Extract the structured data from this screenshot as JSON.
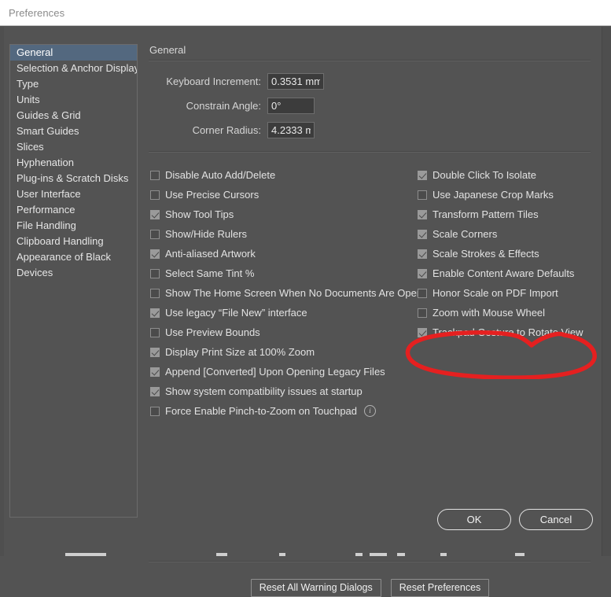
{
  "window": {
    "title": "Preferences"
  },
  "sidebar": {
    "items": [
      {
        "label": "General",
        "selected": true
      },
      {
        "label": "Selection & Anchor Display",
        "selected": false
      },
      {
        "label": "Type",
        "selected": false
      },
      {
        "label": "Units",
        "selected": false
      },
      {
        "label": "Guides & Grid",
        "selected": false
      },
      {
        "label": "Smart Guides",
        "selected": false
      },
      {
        "label": "Slices",
        "selected": false
      },
      {
        "label": "Hyphenation",
        "selected": false
      },
      {
        "label": "Plug-ins & Scratch Disks",
        "selected": false
      },
      {
        "label": "User Interface",
        "selected": false
      },
      {
        "label": "Performance",
        "selected": false
      },
      {
        "label": "File Handling",
        "selected": false
      },
      {
        "label": "Clipboard Handling",
        "selected": false
      },
      {
        "label": "Appearance of Black",
        "selected": false
      },
      {
        "label": "Devices",
        "selected": false
      }
    ]
  },
  "pane": {
    "title": "General",
    "fields": [
      {
        "label": "Keyboard Increment:",
        "value": "0.3531 mm",
        "name": "keyboard-increment"
      },
      {
        "label": "Constrain Angle:",
        "value": "0°",
        "name": "constrain-angle"
      },
      {
        "label": "Corner Radius:",
        "value": "4.2333 m",
        "name": "corner-radius"
      }
    ],
    "checkboxes_left": [
      {
        "label": "Disable Auto Add/Delete",
        "checked": false
      },
      {
        "label": "Use Precise Cursors",
        "checked": false
      },
      {
        "label": "Show Tool Tips",
        "checked": true
      },
      {
        "label": "Show/Hide Rulers",
        "checked": false
      },
      {
        "label": "Anti-aliased Artwork",
        "checked": true
      },
      {
        "label": "Select Same Tint %",
        "checked": false
      },
      {
        "label": "Show The Home Screen When No Documents Are Open",
        "checked": false
      },
      {
        "label": "Use legacy “File New” interface",
        "checked": true
      },
      {
        "label": "Use Preview Bounds",
        "checked": false
      },
      {
        "label": "Display Print Size at 100% Zoom",
        "checked": true
      },
      {
        "label": "Append [Converted] Upon Opening Legacy Files",
        "checked": true
      },
      {
        "label": "Show system compatibility issues at startup",
        "checked": true
      },
      {
        "label": "Force Enable Pinch-to-Zoom on Touchpad",
        "checked": false,
        "info": true
      }
    ],
    "checkboxes_right": [
      {
        "label": "Double Click To Isolate",
        "checked": true
      },
      {
        "label": "Use Japanese Crop Marks",
        "checked": false
      },
      {
        "label": "Transform Pattern Tiles",
        "checked": true
      },
      {
        "label": "Scale Corners",
        "checked": true
      },
      {
        "label": "Scale Strokes & Effects",
        "checked": true
      },
      {
        "label": "Enable Content Aware Defaults",
        "checked": true
      },
      {
        "label": "Honor Scale on PDF Import",
        "checked": false
      },
      {
        "label": "Zoom with Mouse Wheel",
        "checked": false
      },
      {
        "label": "Trackpad Gesture to Rotate View",
        "checked": true,
        "highlighted": true
      }
    ],
    "reset_buttons": [
      {
        "label": "Reset All Warning Dialogs",
        "name": "reset-all-warning-dialogs-button"
      },
      {
        "label": "Reset Preferences",
        "name": "reset-preferences-button"
      }
    ]
  },
  "footer": {
    "ok_label": "OK",
    "cancel_label": "Cancel"
  },
  "annotation": {
    "shape": "red-hand-drawn-circle",
    "color": "#e52020",
    "targets": "Trackpad Gesture to Rotate View"
  },
  "colors": {
    "dialog_background": "#535353",
    "titlebar_background": "#ffffff",
    "selection_highlight": "#53687f",
    "input_background": "#3c3c3c",
    "annotation_red": "#e52020"
  }
}
